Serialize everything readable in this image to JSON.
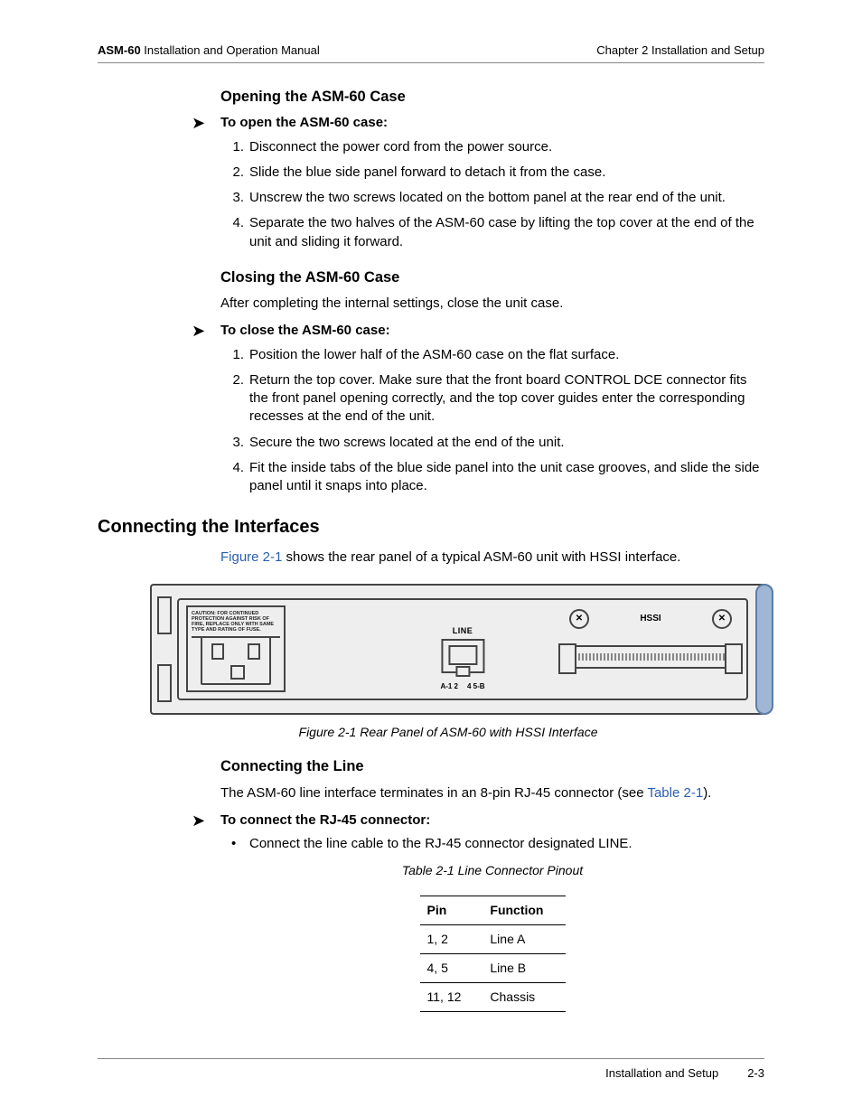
{
  "header": {
    "left_bold": "ASM-60",
    "left_rest": " Installation and Operation Manual",
    "right": "Chapter 2  Installation and Setup"
  },
  "footer": {
    "section": "Installation and Setup",
    "page": "2-3"
  },
  "sec_open": {
    "title": "Opening the ASM-60 Case",
    "lead": "To open the ASM-60 case:",
    "steps": [
      "Disconnect the power cord from the power source.",
      "Slide the blue side panel forward to detach it from the case.",
      "Unscrew the two screws located on the bottom panel at the rear end of the unit.",
      "Separate the two halves of the ASM-60 case by lifting the top cover at the end of the unit and sliding it forward."
    ]
  },
  "sec_close": {
    "title": "Closing the ASM-60 Case",
    "intro": "After completing the internal settings, close the unit case.",
    "lead": "To close the ASM-60 case:",
    "steps": [
      "Position the lower half of the ASM-60 case on the flat surface.",
      "Return the top cover. Make sure that the front board CONTROL DCE connector fits the front panel opening correctly, and the top cover guides enter the corresponding recesses at the end of the unit.",
      "Secure the two screws located at the end of the unit.",
      "Fit the inside tabs of the blue side panel into the unit case grooves, and slide the side panel until it snaps into place."
    ]
  },
  "sec_conn": {
    "title": "Connecting the Interfaces",
    "intro_pre": "",
    "fig_ref": "Figure 2-1",
    "intro_post": " shows the rear panel of a typical ASM-60 unit with HSSI interface."
  },
  "figure": {
    "caption": "Figure 2-1  Rear Panel of ASM-60 with HSSI Interface",
    "psu_caution": "CAUTION:    FOR CONTINUED PROTECTION AGAINST RISK OF FIRE, REPLACE ONLY WITH SAME TYPE AND RATING OF FUSE.",
    "line_label": "LINE",
    "pin_left": "A-1 2",
    "pin_right": "4 5-B",
    "hssi_label": "HSSI"
  },
  "sec_line": {
    "title": "Connecting the Line",
    "intro_pre": "The ASM-60 line interface terminates in an 8-pin RJ-45 connector (see ",
    "tbl_ref": "Table 2-1",
    "intro_post": ").",
    "lead": "To connect the RJ-45 connector:",
    "bullet": "Connect the line cable to the RJ-45 connector designated LINE."
  },
  "table": {
    "caption": "Table 2-1  Line Connector Pinout",
    "headers": {
      "c1": "Pin",
      "c2": "Function"
    },
    "rows": [
      {
        "c1": "1, 2",
        "c2": "Line A"
      },
      {
        "c1": "4, 5",
        "c2": "Line B"
      },
      {
        "c1": "11, 12",
        "c2": "Chassis"
      }
    ]
  }
}
